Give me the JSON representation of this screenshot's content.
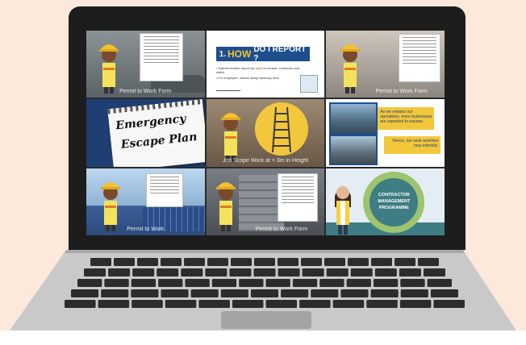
{
  "tiles": {
    "t1": {
      "caption": "Permit to Work Form"
    },
    "t2": {
      "heading_num": "1.",
      "heading_how": "HOW",
      "heading_rest": "DO I REPORT ?",
      "bullet1": "• Submit incident report via",
      "bullet1_link": "Vault",
      "bullet1_end": "for tenant, contractor and visitor",
      "bullet2": "• For employee, submit using hardcopy form"
    },
    "t3": {
      "caption": "Permit to Work Form"
    },
    "t4": {
      "line1": "Emergency",
      "line2": "Escape Plan"
    },
    "t5": {
      "caption": "Job Scope Work at > 3m in Height"
    },
    "t6": {
      "box1": "As we restarts our operations, more businesses are expected to resume.",
      "box2": "Hence, our work activities may intensify."
    },
    "t7": {
      "caption": "Permit to Work"
    },
    "t8": {
      "caption": "Permit to Work Form"
    },
    "t9": {
      "line1": "CONTRACTOR",
      "line2": "MANAGEMENT",
      "line3": "PROGRAMME"
    }
  },
  "colors": {
    "background": "#fce9dc",
    "helmet": "#f2c230",
    "shirt": "#f4e35a",
    "skin": "#7a4a2a",
    "accent_blue": "#1f4e8c",
    "accent_yellow": "#f3c73c",
    "cmp_green": "#9dc46e",
    "cmp_teal": "#3f7d84"
  }
}
